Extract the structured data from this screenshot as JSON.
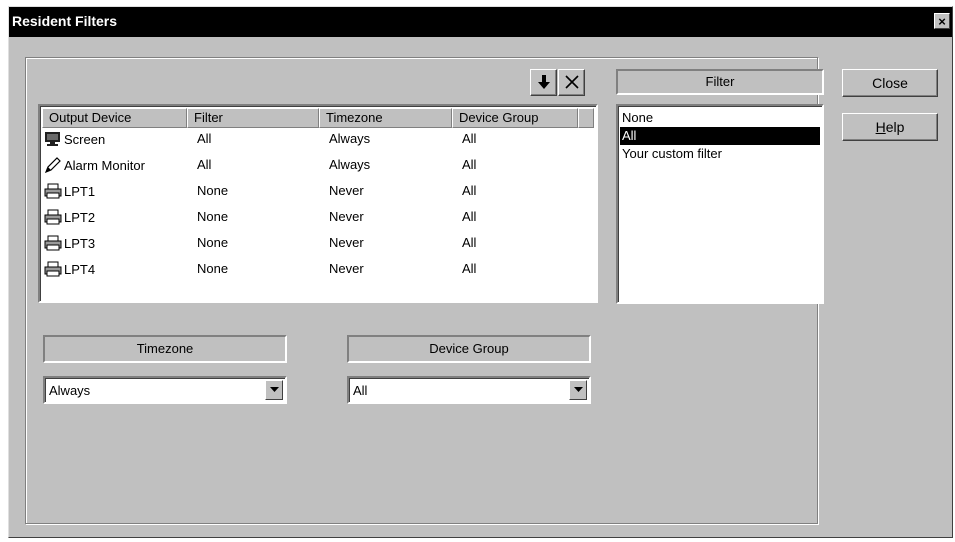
{
  "window": {
    "title": "Resident Filters",
    "close_glyph": "×"
  },
  "toolbar": {
    "down_icon": "arrow-down-icon",
    "delete_icon": "close-icon"
  },
  "table": {
    "columns": [
      "Output Device",
      "Filter",
      "Timezone",
      "Device Group"
    ],
    "rows": [
      {
        "device": "Screen",
        "icon": "monitor-icon",
        "filter": "All",
        "timezone": "Always",
        "group": "All"
      },
      {
        "device": "Alarm Monitor",
        "icon": "pen-icon",
        "filter": "All",
        "timezone": "Always",
        "group": "All"
      },
      {
        "device": "LPT1",
        "icon": "printer-icon",
        "filter": "None",
        "timezone": "Never",
        "group": "All"
      },
      {
        "device": "LPT2",
        "icon": "printer-icon",
        "filter": "None",
        "timezone": "Never",
        "group": "All"
      },
      {
        "device": "LPT3",
        "icon": "printer-icon",
        "filter": "None",
        "timezone": "Never",
        "group": "All"
      },
      {
        "device": "LPT4",
        "icon": "printer-icon",
        "filter": "None",
        "timezone": "Never",
        "group": "All"
      }
    ]
  },
  "filter_panel": {
    "header": "Filter",
    "items": [
      "None",
      "All",
      "Your custom filter"
    ],
    "selected": "All"
  },
  "timezone": {
    "header": "Timezone",
    "value": "Always"
  },
  "device_group": {
    "header": "Device Group",
    "value": "All"
  },
  "buttons": {
    "close": "Close",
    "help_rest": "elp",
    "help_mnemonic": "H"
  }
}
